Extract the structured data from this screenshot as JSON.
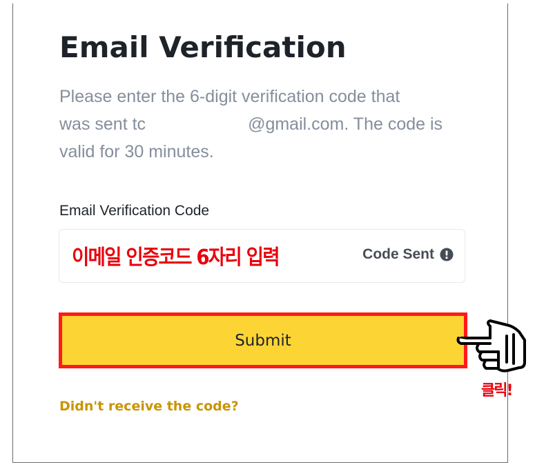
{
  "dialog": {
    "title": "Email Verification",
    "description_line1": "Please enter the 6-digit verification code that",
    "description_line2_start": "was sent tc",
    "description_line2_end": "@gmail.com. The code is",
    "description_line3": "valid for 30 minutes."
  },
  "code_field": {
    "label": "Email Verification Code",
    "annotation": "이메일 인증코드 6자리 입력",
    "status_text": "Code Sent",
    "status_icon": "exclamation-circle-icon"
  },
  "submit": {
    "label": "Submit",
    "color": "#fcd535",
    "highlight_color": "#ff1a1a"
  },
  "resend": {
    "label": "Didn't receive the code?",
    "color": "#c99400"
  },
  "annotation": {
    "pointer_icon": "pointing-hand-icon",
    "click_label": "클릭!"
  }
}
